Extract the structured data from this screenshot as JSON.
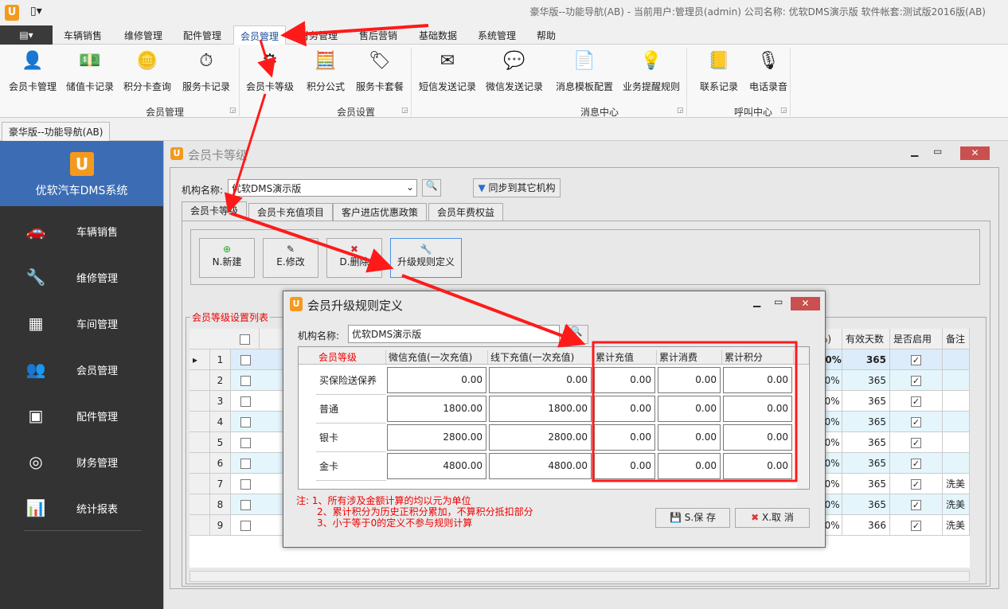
{
  "window": {
    "title": "豪华版--功能导航(AB) - 当前用户:管理员(admin) 公司名称: 优软DMS演示版 软件帐套:测试版2016版(AB)"
  },
  "menu": {
    "tabs": [
      "车辆销售",
      "维修管理",
      "配件管理",
      "会员管理",
      "财务管理",
      "售后营销",
      "基础数据",
      "系统管理",
      "帮助"
    ],
    "active": "会员管理"
  },
  "ribbon": {
    "groups": [
      {
        "label": "会员管理",
        "items": [
          {
            "label": "会员卡管理",
            "icon": "member-card-icon"
          },
          {
            "label": "储值卡记录",
            "icon": "cash-icon"
          },
          {
            "label": "积分卡查询",
            "icon": "coins-icon"
          },
          {
            "label": "服务卡记录",
            "icon": "stopwatch-icon"
          }
        ]
      },
      {
        "label": "会员设置",
        "items": [
          {
            "label": "会员卡等级",
            "icon": "member-settings-icon"
          },
          {
            "label": "积分公式",
            "icon": "calculator-icon"
          },
          {
            "label": "服务卡套餐",
            "icon": "tag-icon"
          }
        ]
      },
      {
        "label": "消息中心",
        "items": [
          {
            "label": "短信发送记录",
            "icon": "sms-icon"
          },
          {
            "label": "微信发送记录",
            "icon": "wechat-icon"
          },
          {
            "label": "消息模板配置",
            "icon": "template-icon"
          },
          {
            "label": "业务提醒规则",
            "icon": "bulb-icon"
          }
        ]
      },
      {
        "label": "呼叫中心",
        "items": [
          {
            "label": "联系记录",
            "icon": "contacts-icon"
          },
          {
            "label": "电话录音",
            "icon": "recorder-icon"
          }
        ]
      }
    ]
  },
  "doc_tab": "豪华版--功能导航(AB)",
  "sidebar": {
    "title": "优软汽车DMS系统",
    "items": [
      {
        "label": "车辆销售",
        "icon": "car-icon"
      },
      {
        "label": "维修管理",
        "icon": "wrench-icon"
      },
      {
        "label": "车间管理",
        "icon": "grid-icon"
      },
      {
        "label": "会员管理",
        "icon": "users-icon"
      },
      {
        "label": "配件管理",
        "icon": "parts-icon"
      },
      {
        "label": "财务管理",
        "icon": "finance-icon"
      },
      {
        "label": "统计报表",
        "icon": "chart-icon"
      }
    ]
  },
  "main": {
    "title": "会员卡等级",
    "org_label": "机构名称:",
    "org_value": "优软DMS演示版",
    "sync_label": "同步到其它机构",
    "tabs": [
      "会员卡等级",
      "会员卡充值项目",
      "客户进店优惠政策",
      "会员年费权益"
    ],
    "toolbar": {
      "new": "N.新建",
      "edit": "E.修改",
      "delete": "D.删除",
      "upgrade": "升级规则定义"
    },
    "list_title": "会员等级设置列表",
    "grid": {
      "headers_right": [
        "%)",
        "有效天数",
        "是否启用",
        "备注"
      ],
      "rows": [
        {
          "no": "1",
          "pct": "00%",
          "days": "365",
          "enabled": true,
          "note": ""
        },
        {
          "no": "2",
          "pct": "00%",
          "days": "365",
          "enabled": true,
          "note": ""
        },
        {
          "no": "3",
          "pct": "00%",
          "days": "365",
          "enabled": true,
          "note": ""
        },
        {
          "no": "4",
          "pct": "00%",
          "days": "365",
          "enabled": true,
          "note": ""
        },
        {
          "no": "5",
          "pct": "00%",
          "days": "365",
          "enabled": true,
          "note": ""
        },
        {
          "no": "6",
          "pct": "00%",
          "days": "365",
          "enabled": true,
          "note": ""
        },
        {
          "no": "7",
          "pct": "00%",
          "days": "365",
          "enabled": true,
          "note": "洗美"
        },
        {
          "no": "8",
          "pct": "00%",
          "days": "365",
          "enabled": true,
          "note": "洗美"
        },
        {
          "no": "9",
          "pct": "00%",
          "days": "366",
          "enabled": true,
          "note": "洗美"
        }
      ]
    }
  },
  "dialog": {
    "title": "会员升级规则定义",
    "org_label": "机构名称:",
    "org_value": "优软DMS演示版",
    "headers": [
      "会员等级",
      "微信充值(一次充值)",
      "线下充值(一次充值)",
      "累计充值",
      "累计消费",
      "累计积分"
    ],
    "rows": [
      {
        "level": "买保险送保养",
        "wechat": "0.00",
        "offline": "0.00",
        "total_recharge": "0.00",
        "total_spend": "0.00",
        "total_points": "0.00"
      },
      {
        "level": "普通",
        "wechat": "1800.00",
        "offline": "1800.00",
        "total_recharge": "0.00",
        "total_spend": "0.00",
        "total_points": "0.00"
      },
      {
        "level": "银卡",
        "wechat": "2800.00",
        "offline": "2800.00",
        "total_recharge": "0.00",
        "total_spend": "0.00",
        "total_points": "0.00"
      },
      {
        "level": "金卡",
        "wechat": "4800.00",
        "offline": "4800.00",
        "total_recharge": "0.00",
        "total_spend": "0.00",
        "total_points": "0.00"
      }
    ],
    "notes": [
      "注: 1、所有涉及金额计算的均以元为单位",
      "2、累计积分为历史正积分累加，不算积分抵扣部分",
      "3、小于等于0的定义不参与规则计算"
    ],
    "save": "S.保 存",
    "cancel": "X.取 消"
  },
  "colors": {
    "accent": "#3c6db4",
    "annotation": "#ff1a1a",
    "close": "#c9504f"
  }
}
